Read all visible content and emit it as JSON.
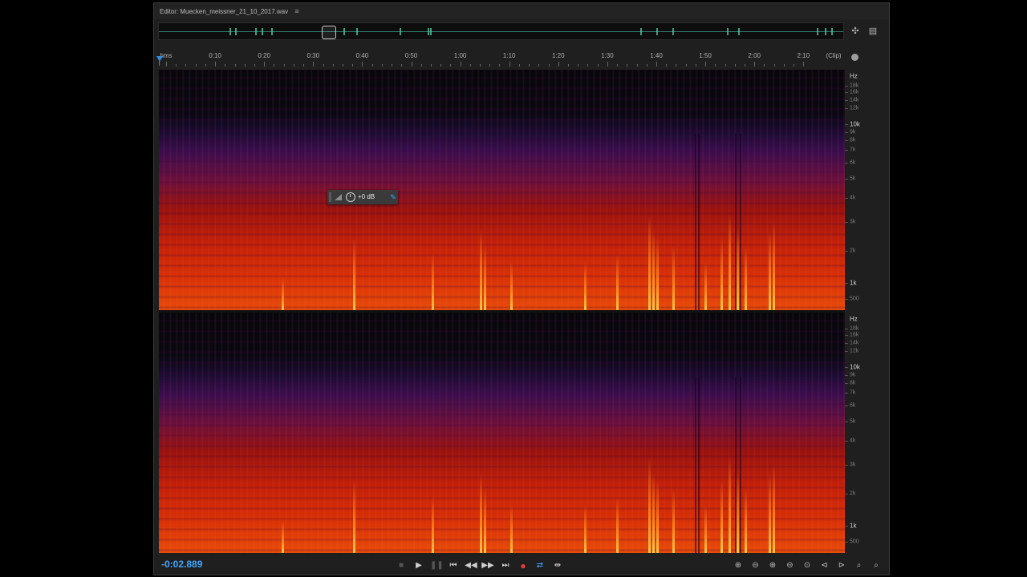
{
  "editor": {
    "title": "Editor: Muecken_meissner_21_10_2017.wav",
    "menu_icon": "hamburger-icon"
  },
  "overview": {
    "zoom_icon": "zoom-to-selection-icon",
    "panel_icon": "panel-menu-icon"
  },
  "ruler": {
    "start_label": "hms",
    "labels": [
      "0:10",
      "0:20",
      "0:30",
      "0:40",
      "0:50",
      "1:00",
      "1:10",
      "1:20",
      "1:30",
      "1:40",
      "1:50",
      "2:00",
      "2:10"
    ],
    "end_label": "(Clip)"
  },
  "channels": [
    {
      "unit": "Hz",
      "labels": [
        {
          "text": "18k",
          "major": false
        },
        {
          "text": "16k",
          "major": false
        },
        {
          "text": "14k",
          "major": false
        },
        {
          "text": "12k",
          "major": false
        },
        {
          "text": "10k",
          "major": true
        },
        {
          "text": "9k",
          "major": false
        },
        {
          "text": "8k",
          "major": false
        },
        {
          "text": "7k",
          "major": false
        },
        {
          "text": "6k",
          "major": false
        },
        {
          "text": "5k",
          "major": false
        },
        {
          "text": "4k",
          "major": false
        },
        {
          "text": "3k",
          "major": false
        },
        {
          "text": "2k",
          "major": false
        },
        {
          "text": "1k",
          "major": true
        },
        {
          "text": "500",
          "major": false
        }
      ]
    },
    {
      "unit": "Hz",
      "labels": [
        {
          "text": "18k",
          "major": false
        },
        {
          "text": "16k",
          "major": false
        },
        {
          "text": "14k",
          "major": false
        },
        {
          "text": "12k",
          "major": false
        },
        {
          "text": "10k",
          "major": true
        },
        {
          "text": "9k",
          "major": false
        },
        {
          "text": "8k",
          "major": false
        },
        {
          "text": "7k",
          "major": false
        },
        {
          "text": "6k",
          "major": false
        },
        {
          "text": "5k",
          "major": false
        },
        {
          "text": "4k",
          "major": false
        },
        {
          "text": "3k",
          "major": false
        },
        {
          "text": "2k",
          "major": false
        },
        {
          "text": "1k",
          "major": true
        },
        {
          "text": "500",
          "major": false
        }
      ]
    }
  ],
  "hud": {
    "gain_label": "+0 dB",
    "meter_icon": "volume-meter-icon",
    "knob_icon": "gain-knob-icon",
    "pin_icon": "pin-icon"
  },
  "time_display": "-0:02.889",
  "colors": {
    "accent": "#3fa6ff",
    "record": "#e83a3a",
    "panel": "#1f1f1f"
  },
  "transport": [
    {
      "name": "stop-button",
      "icon": "stop-icon",
      "glyph": "■",
      "dim": true
    },
    {
      "name": "play-button",
      "icon": "play-icon",
      "glyph": "▶",
      "dim": false
    },
    {
      "name": "pause-button",
      "icon": "pause-icon",
      "glyph": "❚❚",
      "dim": true
    },
    {
      "name": "go-to-start-button",
      "icon": "skip-back-icon",
      "glyph": "⏮",
      "dim": false
    },
    {
      "name": "rewind-button",
      "icon": "rewind-icon",
      "glyph": "◀◀",
      "dim": false
    },
    {
      "name": "fast-forward-button",
      "icon": "fast-forward-icon",
      "glyph": "▶▶",
      "dim": false
    },
    {
      "name": "go-to-end-button",
      "icon": "skip-forward-icon",
      "glyph": "⏭",
      "dim": false
    },
    {
      "name": "record-button",
      "icon": "record-icon",
      "glyph": "●",
      "rec": true
    },
    {
      "name": "loop-button",
      "icon": "loop-icon",
      "glyph": "⇄",
      "loop": true
    },
    {
      "name": "skip-selection-button",
      "icon": "skip-selection-icon",
      "glyph": "⇹",
      "dim": false
    }
  ],
  "zoom": [
    {
      "name": "zoom-in-amplitude-button",
      "icon": "zoom-in-amplitude-icon",
      "glyph": "⊕"
    },
    {
      "name": "zoom-out-amplitude-button",
      "icon": "zoom-out-amplitude-icon",
      "glyph": "⊖"
    },
    {
      "name": "zoom-in-time-button",
      "icon": "zoom-in-time-icon",
      "glyph": "⊕"
    },
    {
      "name": "zoom-out-time-button",
      "icon": "zoom-out-time-icon",
      "glyph": "⊖"
    },
    {
      "name": "zoom-out-full-button",
      "icon": "zoom-out-full-icon",
      "glyph": "⊙"
    },
    {
      "name": "zoom-in-point-button",
      "icon": "zoom-in-point-icon",
      "glyph": "⊲"
    },
    {
      "name": "zoom-selection-button",
      "icon": "zoom-selection-icon",
      "glyph": "⊳"
    },
    {
      "name": "zoom-left-button",
      "icon": "zoom-left-edge-icon",
      "glyph": "⌕"
    },
    {
      "name": "zoom-right-button",
      "icon": "zoom-right-edge-icon",
      "glyph": "⌕"
    }
  ]
}
